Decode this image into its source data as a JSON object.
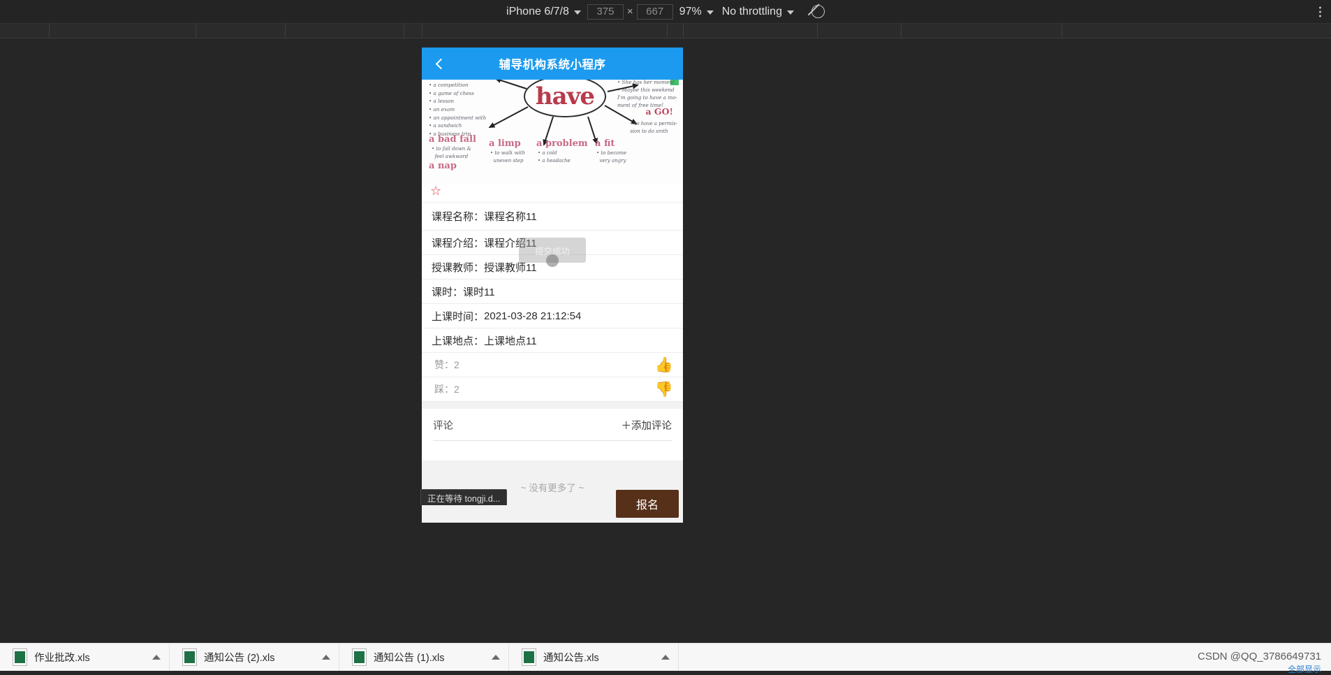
{
  "devtools": {
    "device_name": "iPhone 6/7/8",
    "width_value": "375",
    "dimension_separator": "×",
    "height_value": "667",
    "zoom_level": "97%",
    "throttling": "No throttling",
    "rotate_icon": "no-rotate-icon",
    "menu_icon": "kebab-menu-icon"
  },
  "app": {
    "title": "辅导机构系统小程序",
    "back_icon": "chevron-left-icon",
    "header_color": "#1c9aef"
  },
  "banner": {
    "center_word": "have",
    "left_items": [
      "• a competition",
      "• a game of chess",
      "• a lesson",
      "• an exam",
      "• an appointment with",
      "• a sandwich",
      "• a business trip"
    ],
    "right_items": [
      "• She has her moment",
      "• Maybe this weekend",
      "I'm going to have a mo-",
      "ment of free time!"
    ],
    "go_label": "a GO!",
    "go_sub": "• to have a permis-\nsion to do smth",
    "terms": [
      {
        "title": "a bad fall",
        "sub": "• to fall down &\n  feel awkward"
      },
      {
        "title": "a limp",
        "sub": "• to walk with\n  uneven step"
      },
      {
        "title": "a problem",
        "sub": "• a cold\n• a headache"
      },
      {
        "title": "a fit",
        "sub": "• to become\n  very angry"
      },
      {
        "title": "a nap",
        "sub": ""
      }
    ],
    "star_icon": "star-outline-icon"
  },
  "course": {
    "rows": [
      {
        "label": "课程名称：",
        "value": "课程名称11"
      },
      {
        "label": "课程介绍：",
        "value": "课程介绍11"
      },
      {
        "label": "授课教师：",
        "value": "授课教师11"
      },
      {
        "label": "课时：",
        "value": "课时11"
      },
      {
        "label": "上课时间：",
        "value": "2021-03-28 21:12:54"
      },
      {
        "label": "上课地点：",
        "value": "上课地点11"
      }
    ],
    "like": {
      "label": "赞：",
      "count": "2",
      "icon": "thumbs-up-icon",
      "color": "#f7b500"
    },
    "dislike": {
      "label": "踩：",
      "count": "2",
      "icon": "thumbs-down-icon",
      "color": "#12b886"
    }
  },
  "comments": {
    "title": "评论",
    "add_label": "＋添加评论",
    "empty_text": "~ 没有更多了 ~"
  },
  "actions": {
    "signup_label": "报名",
    "signup_color": "#57301a"
  },
  "toast": {
    "message": "提交成功",
    "spinner": "loading-spinner"
  },
  "browser_status": {
    "text": "正在等待 tongji.d..."
  },
  "taskbar": {
    "items": [
      {
        "label": "作业批改.xls",
        "icon": "excel-file-icon",
        "caret": "chevron-up-icon"
      },
      {
        "label": "通知公告 (2).xls",
        "icon": "excel-file-icon",
        "caret": "chevron-up-icon"
      },
      {
        "label": "通知公告 (1).xls",
        "icon": "excel-file-icon",
        "caret": "chevron-up-icon"
      },
      {
        "label": "通知公告.xls",
        "icon": "excel-file-icon",
        "caret": "chevron-up-icon"
      }
    ]
  },
  "watermark": {
    "main": "CSDN @QQ_3786649731",
    "sub": "全部显示"
  }
}
